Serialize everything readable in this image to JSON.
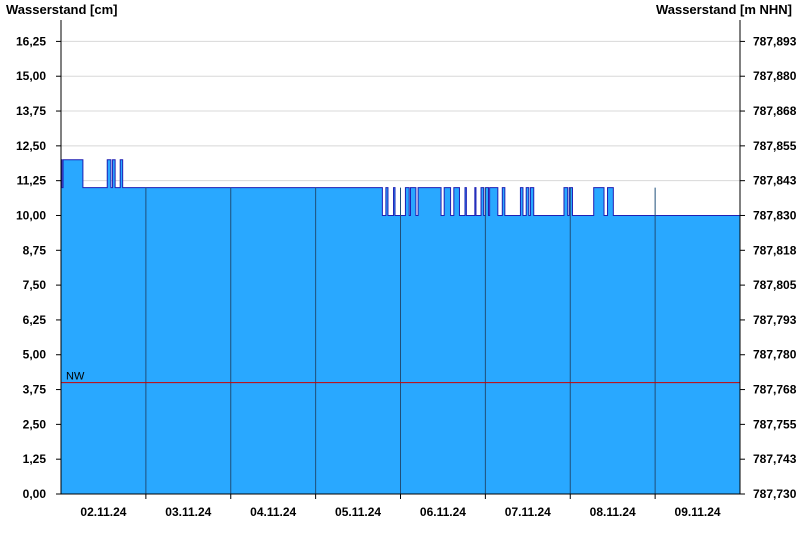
{
  "chart_data": {
    "type": "area",
    "ylabel_left": "Wasserstand [cm]",
    "ylabel_right": "Wasserstand [m NHN]",
    "ylim": [
      0,
      16.875
    ],
    "y_ticks_left": [
      "0,00",
      "1,25",
      "2,50",
      "3,75",
      "5,00",
      "6,25",
      "7,50",
      "8,75",
      "10,00",
      "11,25",
      "12,50",
      "13,75",
      "15,00",
      "16,25"
    ],
    "y_ticks_right": [
      "787,730",
      "787,743",
      "787,755",
      "787,768",
      "787,780",
      "787,793",
      "787,805",
      "787,818",
      "787,830",
      "787,843",
      "787,855",
      "787,868",
      "787,880",
      "787,893"
    ],
    "x_range_days": [
      0,
      8
    ],
    "x_tick_labels": [
      "02.11.24",
      "03.11.24",
      "04.11.24",
      "05.11.24",
      "06.11.24",
      "07.11.24",
      "08.11.24",
      "09.11.24"
    ],
    "threshold": {
      "label": "NW",
      "value": 4,
      "color": "#cc0000"
    },
    "baseline_periods": [
      {
        "from_day": 0.0,
        "to_day": 0.58,
        "base": 11,
        "spike_to": 12
      },
      {
        "from_day": 0.58,
        "to_day": 3.7,
        "base": 11,
        "spike_to": 12
      },
      {
        "from_day": 3.7,
        "to_day": 5.55,
        "base": 10,
        "spike_to": 11
      },
      {
        "from_day": 5.55,
        "to_day": 8.0,
        "base": 10,
        "spike_to": 11
      }
    ],
    "fill_color": "#29a8ff",
    "line_color": "#1f1fb4"
  }
}
